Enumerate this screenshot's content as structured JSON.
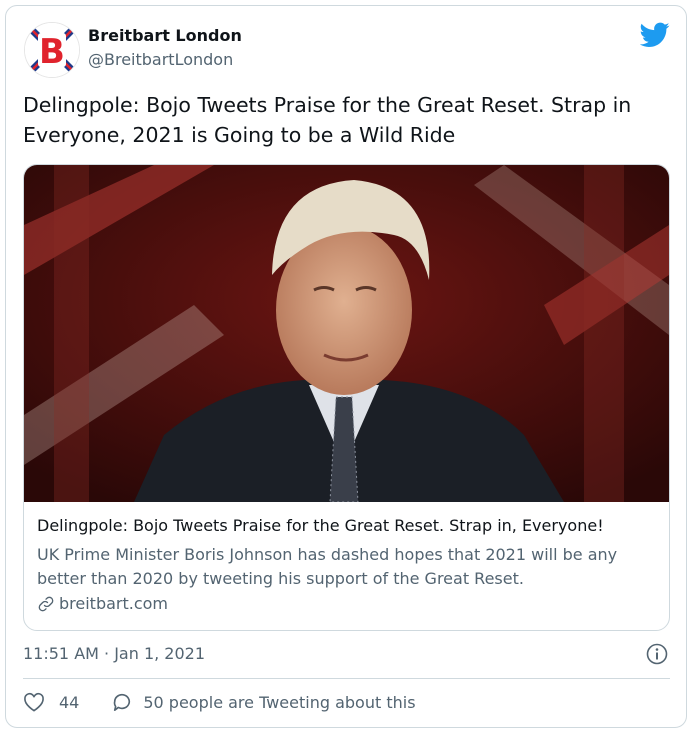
{
  "author": {
    "name": "Breitbart London",
    "handle": "@BreitbartLondon",
    "avatar_icon": "breitbart-b-union-jack-logo"
  },
  "brand_icon": "twitter-bird-icon",
  "tweet": {
    "text": "Delingpole: Bojo Tweets Praise for the Great Reset. Strap in Everyone, 2021 is Going to be a Wild Ride"
  },
  "link_card": {
    "image_icon": "boris-johnson-photo",
    "title": "Delingpole: Bojo Tweets Praise for the Great Reset. Strap in, Everyone!",
    "description": "UK Prime Minister Boris Johnson has dashed hopes that 2021 will be any better than 2020 by tweeting his support of the Great Reset.",
    "domain": "breitbart.com",
    "domain_icon": "link-icon"
  },
  "meta": {
    "timestamp": "11:51 AM · Jan 1, 2021",
    "info_icon": "info-icon"
  },
  "actions": {
    "like_icon": "heart-icon",
    "likes": "44",
    "reply_icon": "speech-bubble-icon",
    "conversation_label": "50 people are Tweeting about this"
  },
  "colors": {
    "text": "#0f1419",
    "secondary": "#536471",
    "border": "#cfd9de",
    "twitter_blue": "#1d9bf0",
    "brand_red": "#e0232d",
    "brand_navy": "#1f3a8a"
  }
}
